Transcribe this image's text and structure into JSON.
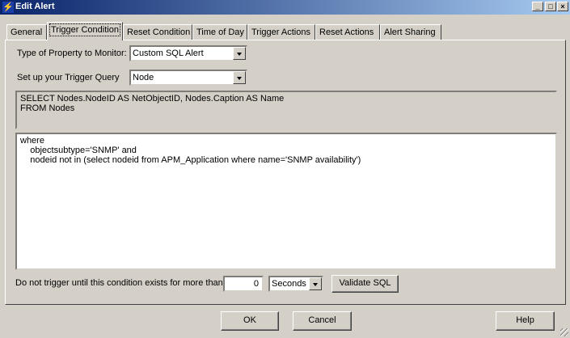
{
  "window": {
    "title": "Edit Alert"
  },
  "tabs": [
    {
      "label": "General"
    },
    {
      "label": "Trigger Condition"
    },
    {
      "label": "Reset Condition"
    },
    {
      "label": "Time of Day"
    },
    {
      "label": "Trigger Actions"
    },
    {
      "label": "Reset Actions"
    },
    {
      "label": "Alert Sharing"
    }
  ],
  "form": {
    "property_label": "Type of Property to Monitor:",
    "property_value": "Custom SQL Alert",
    "query_label": "Set up your Trigger Query",
    "query_value": "Node",
    "sql_select": "SELECT Nodes.NodeID AS NetObjectID, Nodes.Caption AS Name\nFROM Nodes",
    "sql_where": "where\n    objectsubtype='SNMP' and\n    nodeid not in (select nodeid from APM_Application where name='SNMP availability')",
    "delay_label": "Do not trigger until this condition exists for more than",
    "delay_value": "0",
    "delay_unit": "Seconds",
    "validate_label": "Validate SQL"
  },
  "footer": {
    "ok": "OK",
    "cancel": "Cancel",
    "help": "Help"
  }
}
